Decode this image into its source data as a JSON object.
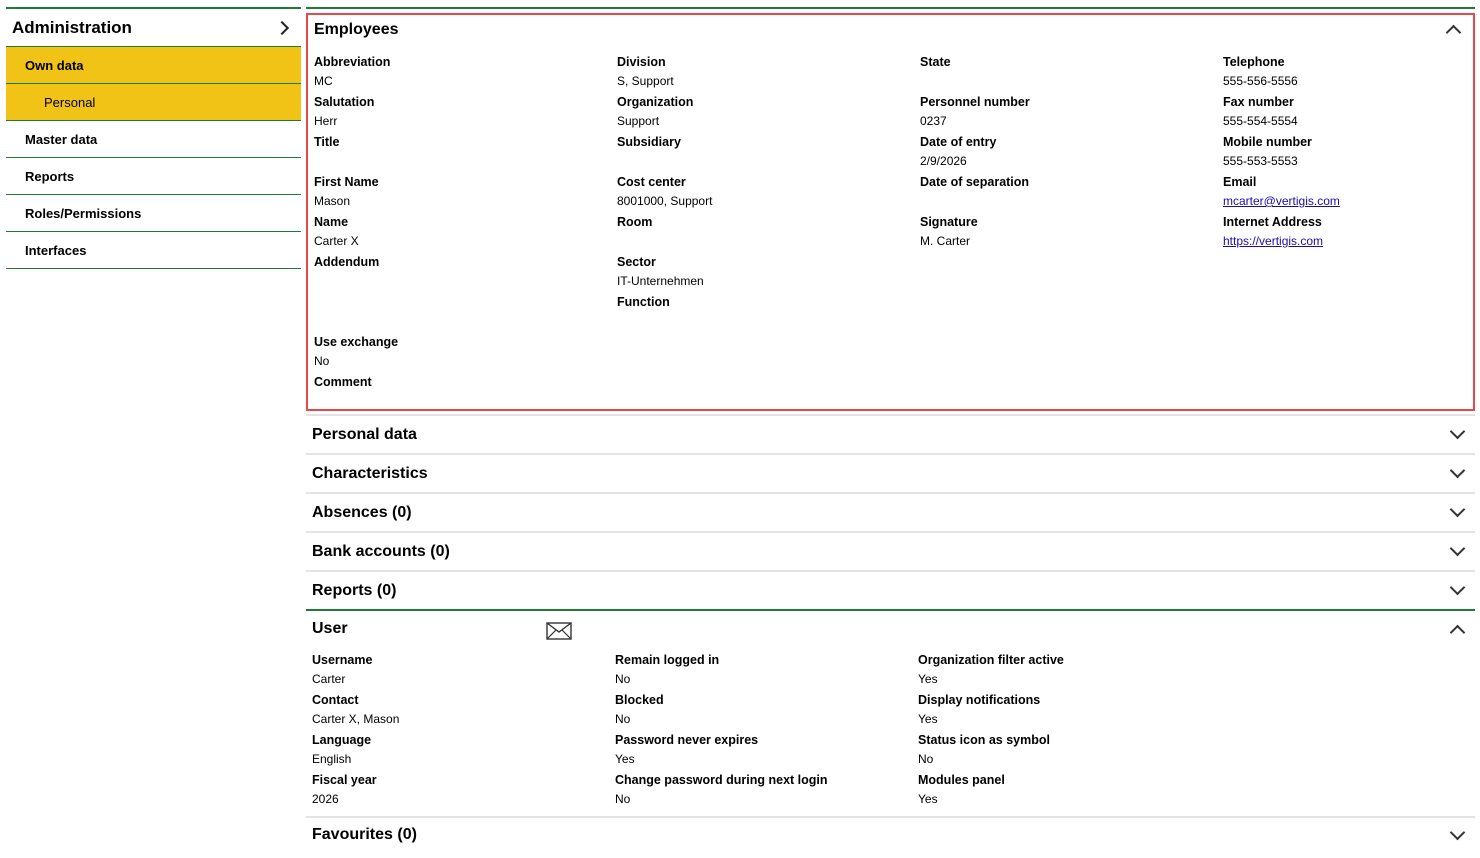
{
  "sidebar": {
    "title": "Administration",
    "items": [
      {
        "label": "Own data"
      },
      {
        "label": "Personal"
      },
      {
        "label": "Master data"
      },
      {
        "label": "Reports"
      },
      {
        "label": "Roles/Permissions"
      },
      {
        "label": "Interfaces"
      }
    ]
  },
  "employees": {
    "title": "Employees",
    "fields": {
      "abbreviation": {
        "label": "Abbreviation",
        "value": "MC"
      },
      "salutation": {
        "label": "Salutation",
        "value": "Herr"
      },
      "title": {
        "label": "Title",
        "value": ""
      },
      "first_name": {
        "label": "First Name",
        "value": "Mason"
      },
      "name": {
        "label": "Name",
        "value": "Carter X"
      },
      "addendum": {
        "label": "Addendum",
        "value": ""
      },
      "use_exchange": {
        "label": "Use exchange",
        "value": "No"
      },
      "comment": {
        "label": "Comment",
        "value": ""
      },
      "division": {
        "label": "Division",
        "value": "S, Support"
      },
      "organization": {
        "label": "Organization",
        "value": "Support"
      },
      "subsidiary": {
        "label": "Subsidiary",
        "value": ""
      },
      "cost_center": {
        "label": "Cost center",
        "value": "8001000, Support"
      },
      "room": {
        "label": "Room",
        "value": ""
      },
      "sector": {
        "label": "Sector",
        "value": "IT-Unternehmen"
      },
      "function": {
        "label": "Function",
        "value": ""
      },
      "state": {
        "label": "State",
        "value": ""
      },
      "personnel_number": {
        "label": "Personnel number",
        "value": "0237"
      },
      "date_of_entry": {
        "label": "Date of entry",
        "value": "2/9/2026"
      },
      "date_of_separation": {
        "label": "Date of separation",
        "value": ""
      },
      "signature": {
        "label": "Signature",
        "value": "M. Carter"
      },
      "telephone": {
        "label": "Telephone",
        "value": "555-556-5556"
      },
      "fax_number": {
        "label": "Fax number",
        "value": "555-554-5554"
      },
      "mobile_number": {
        "label": "Mobile number",
        "value": "555-553-5553"
      },
      "email": {
        "label": "Email",
        "value": "mcarter@vertigis.com"
      },
      "internet_address": {
        "label": "Internet Address",
        "value": "https://vertigis.com"
      }
    }
  },
  "sections": {
    "personal_data": "Personal data",
    "characteristics": "Characteristics",
    "absences": "Absences (0)",
    "bank_accounts": "Bank accounts (0)",
    "reports": "Reports (0)",
    "favourites": "Favourites (0)"
  },
  "user": {
    "title": "User",
    "fields": {
      "username": {
        "label": "Username",
        "value": "Carter"
      },
      "contact": {
        "label": "Contact",
        "value": "Carter X, Mason"
      },
      "language": {
        "label": "Language",
        "value": "English"
      },
      "fiscal_year": {
        "label": "Fiscal year",
        "value": "2026"
      },
      "remain_logged_in": {
        "label": "Remain logged in",
        "value": "No"
      },
      "blocked": {
        "label": "Blocked",
        "value": "No"
      },
      "password_never_expires": {
        "label": "Password never expires",
        "value": "Yes"
      },
      "change_password": {
        "label": "Change password during next login",
        "value": "No"
      },
      "org_filter_active": {
        "label": "Organization filter active",
        "value": "Yes"
      },
      "display_notifications": {
        "label": "Display notifications",
        "value": "Yes"
      },
      "status_icon_as_symbol": {
        "label": "Status icon as symbol",
        "value": "No"
      },
      "modules_panel": {
        "label": "Modules panel",
        "value": "Yes"
      }
    }
  },
  "colors": {
    "accent_green": "#1e7a35",
    "active_yellow": "#f2c317",
    "highlight_red": "#e8484c"
  }
}
